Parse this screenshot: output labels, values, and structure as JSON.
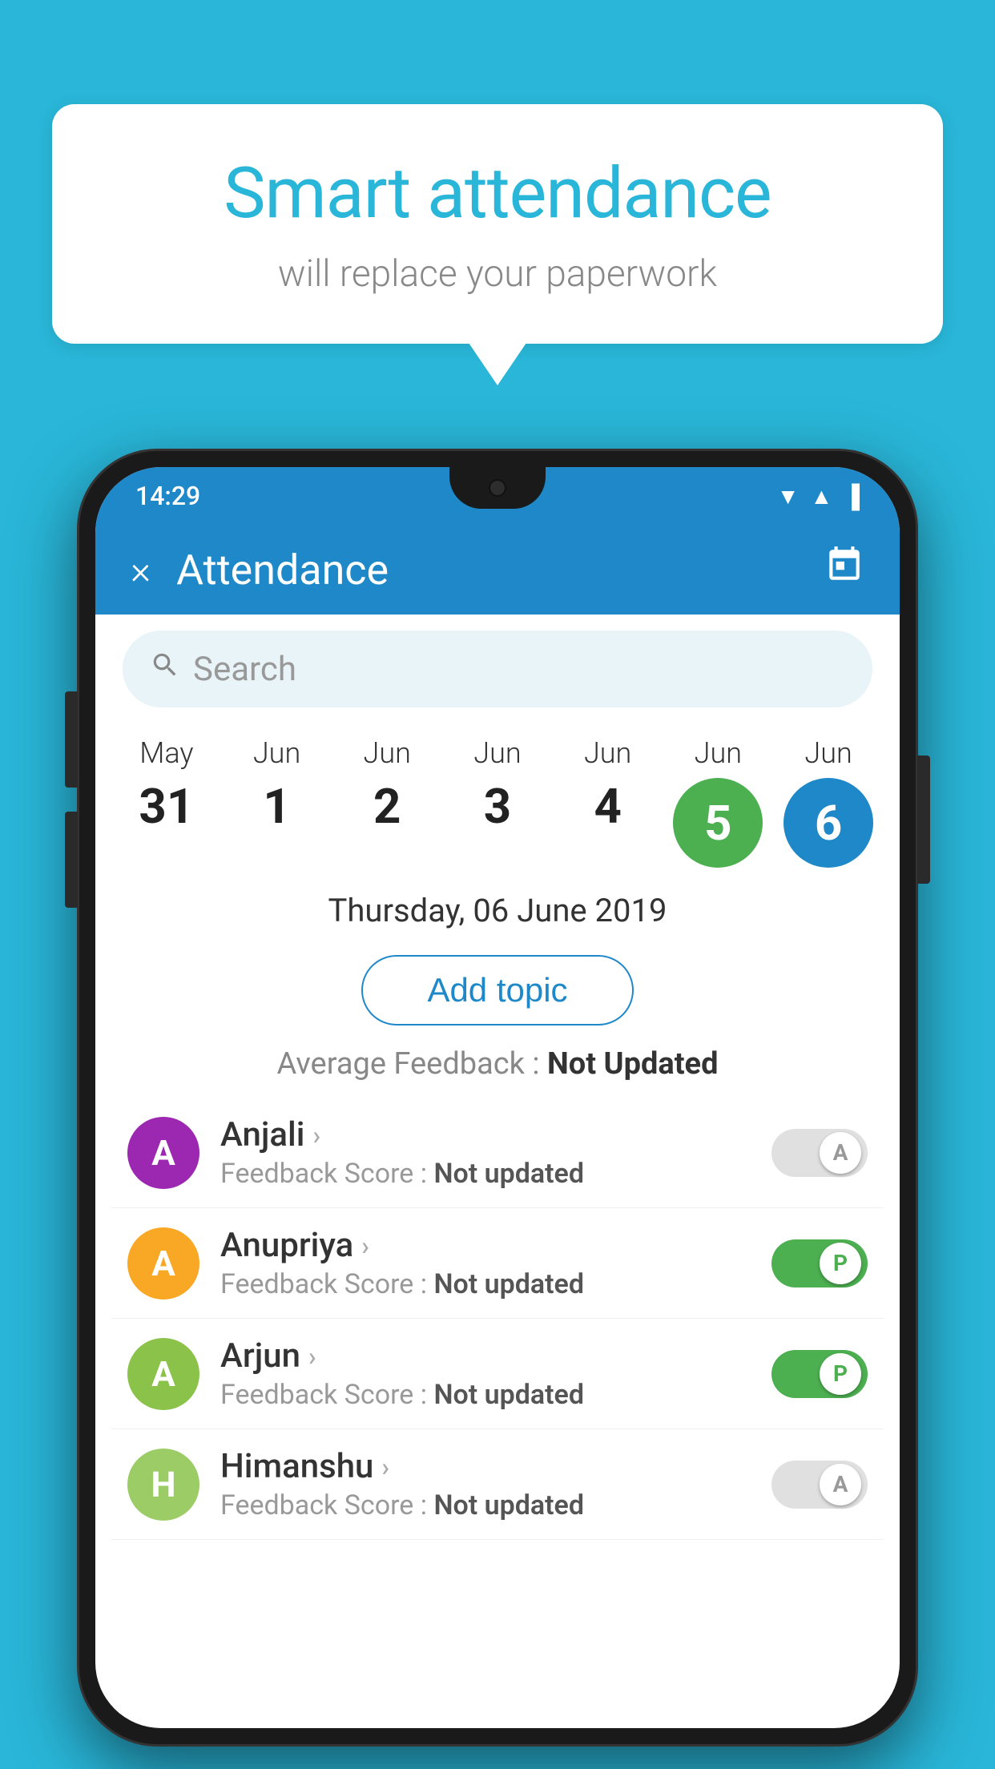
{
  "background_color": "#29b6d8",
  "speech_bubble": {
    "title": "Smart attendance",
    "subtitle": "will replace your paperwork"
  },
  "status_bar": {
    "time": "14:29",
    "icons": [
      "wifi",
      "signal",
      "battery"
    ]
  },
  "header": {
    "title": "Attendance",
    "close_label": "×",
    "calendar_icon": "📅"
  },
  "search": {
    "placeholder": "Search"
  },
  "date_strip": {
    "dates": [
      {
        "month": "May",
        "day": "31",
        "highlight": "none"
      },
      {
        "month": "Jun",
        "day": "1",
        "highlight": "none"
      },
      {
        "month": "Jun",
        "day": "2",
        "highlight": "none"
      },
      {
        "month": "Jun",
        "day": "3",
        "highlight": "none"
      },
      {
        "month": "Jun",
        "day": "4",
        "highlight": "none"
      },
      {
        "month": "Jun",
        "day": "5",
        "highlight": "green"
      },
      {
        "month": "Jun",
        "day": "6",
        "highlight": "blue"
      }
    ]
  },
  "selected_date": "Thursday, 06 June 2019",
  "add_topic_label": "Add topic",
  "avg_feedback_label": "Average Feedback :",
  "avg_feedback_value": "Not Updated",
  "students": [
    {
      "name": "Anjali",
      "avatar_letter": "A",
      "avatar_color": "purple",
      "feedback_label": "Feedback Score :",
      "feedback_value": "Not updated",
      "attendance": "A",
      "toggle_state": "off"
    },
    {
      "name": "Anupriya",
      "avatar_letter": "A",
      "avatar_color": "yellow",
      "feedback_label": "Feedback Score :",
      "feedback_value": "Not updated",
      "attendance": "P",
      "toggle_state": "on"
    },
    {
      "name": "Arjun",
      "avatar_letter": "A",
      "avatar_color": "green",
      "feedback_label": "Feedback Score :",
      "feedback_value": "Not updated",
      "attendance": "P",
      "toggle_state": "on"
    },
    {
      "name": "Himanshu",
      "avatar_letter": "H",
      "avatar_color": "olive",
      "feedback_label": "Feedback Score :",
      "feedback_value": "Not updated",
      "attendance": "A",
      "toggle_state": "off"
    }
  ]
}
